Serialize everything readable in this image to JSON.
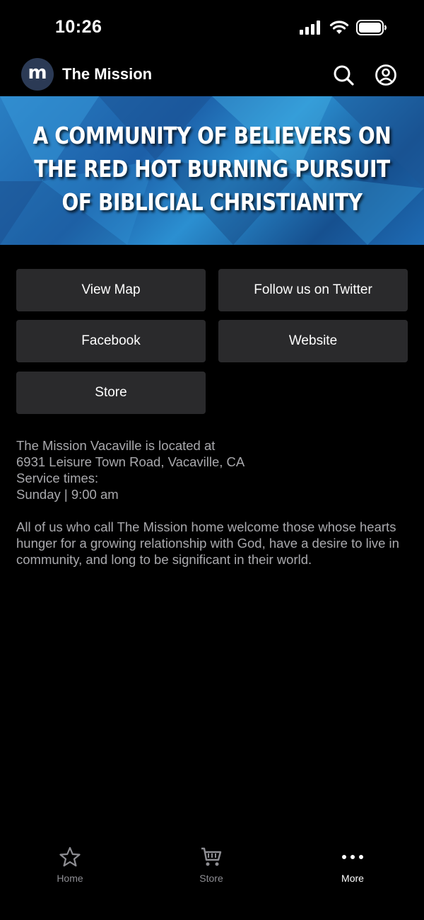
{
  "status": {
    "time": "10:26"
  },
  "header": {
    "logo_letter": "m",
    "title": "The Mission"
  },
  "banner": {
    "lines": [
      "A COMMUNITY OF BELIEVERS ON",
      "THE RED HOT BURNING PURSUIT",
      "OF BIBLICIAL CHRISTIANITY"
    ]
  },
  "buttons": [
    {
      "label": "View Map"
    },
    {
      "label": "Follow us on Twitter"
    },
    {
      "label": "Facebook"
    },
    {
      "label": "Website"
    },
    {
      "label": "Store"
    }
  ],
  "info": {
    "line1": "The Mission Vacaville is located at",
    "line2": "6931 Leisure Town Road, Vacaville, CA",
    "line3": "Service times:",
    "line4": "Sunday | 9:00 am",
    "paragraph": "All of us who call The Mission home welcome those whose hearts hunger for a growing relationship with God, have a desire to live in community, and long to be significant in their world."
  },
  "tabs": [
    {
      "label": "Home",
      "icon": "star-icon",
      "active": false
    },
    {
      "label": "Store",
      "icon": "cart-icon",
      "active": false
    },
    {
      "label": "More",
      "icon": "more-dots-icon",
      "active": true
    }
  ],
  "colors": {
    "background": "#000000",
    "button": "#2a2a2c",
    "body_text": "#a9a9ad",
    "inactive_tab": "#8e8e93",
    "active_tab": "#ffffff"
  }
}
